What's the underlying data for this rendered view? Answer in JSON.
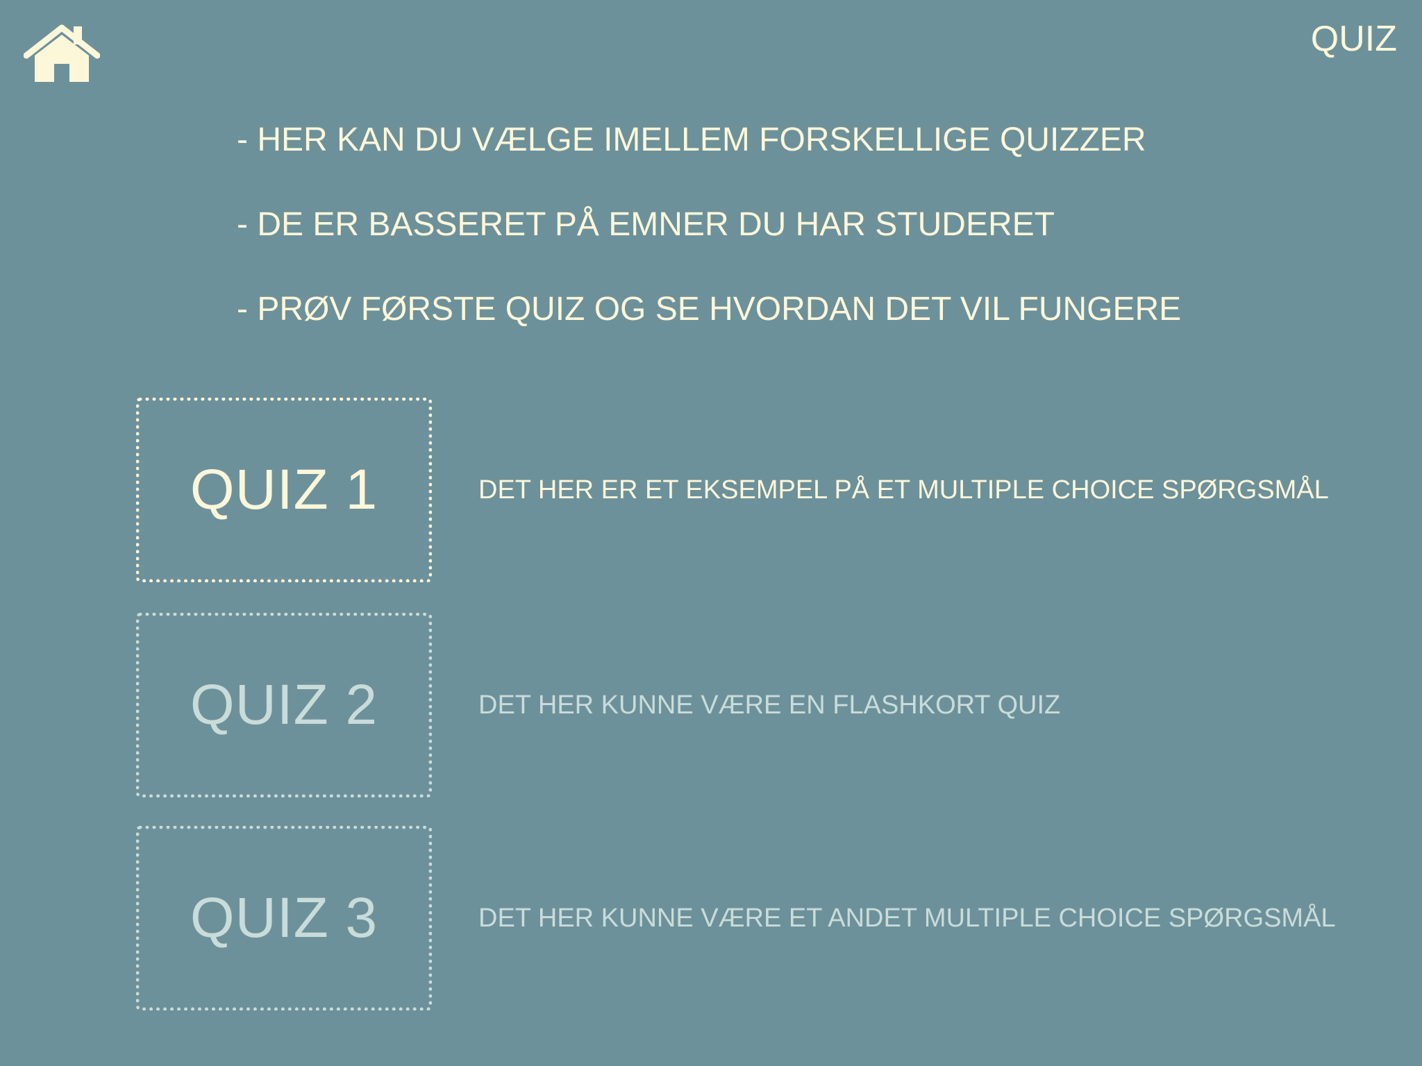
{
  "header": {
    "title": "QUIZ",
    "home_icon": "home-icon"
  },
  "intro": {
    "lines": [
      "- HER KAN DU VÆLGE IMELLEM FORSKELLIGE QUIZZER",
      "- DE ER BASSERET PÅ EMNER DU HAR STUDERET",
      "- PRØV FØRSTE QUIZ OG SE HVORDAN DET VIL FUNGERE"
    ]
  },
  "quizzes": [
    {
      "label": "QUIZ 1",
      "description": "DET HER ER ET EKSEMPEL PÅ ET MULTIPLE CHOICE SPØRGSMÅL",
      "active": true
    },
    {
      "label": "QUIZ 2",
      "description": "DET HER KUNNE VÆRE EN FLASHKORT QUIZ",
      "active": false
    },
    {
      "label": "QUIZ 3",
      "description": "DET HER KUNNE VÆRE ET ANDET MULTIPLE CHOICE SPØRGSMÅL",
      "active": false
    }
  ],
  "colors": {
    "background": "#6d919a",
    "active_text": "#fdf7da",
    "inactive_text": "#c9dcda"
  }
}
